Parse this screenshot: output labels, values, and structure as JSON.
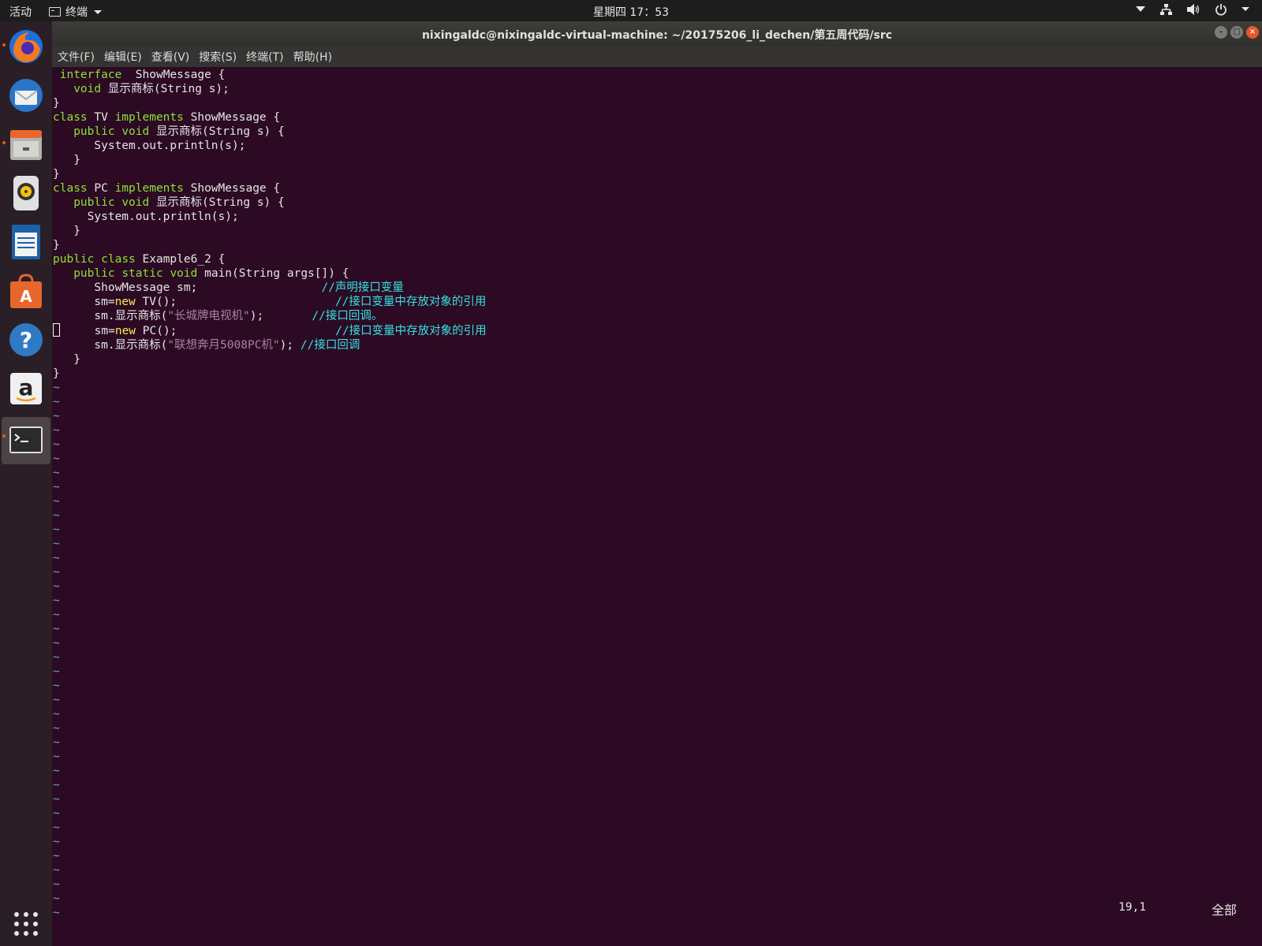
{
  "topbar": {
    "activities": "活动",
    "app_menu": "终端",
    "clock": "星期四 17：53"
  },
  "window": {
    "title": "nixingaldc@nixingaldc-virtual-machine: ~/20175206_li_dechen/第五周代码/src",
    "menu": [
      "文件(F)",
      "编辑(E)",
      "查看(V)",
      "搜索(S)",
      "终端(T)",
      "帮助(H)"
    ]
  },
  "dock": {
    "items": [
      "firefox-icon",
      "thunderbird-icon",
      "files-icon",
      "rhythmbox-icon",
      "writer-icon",
      "software-center-icon",
      "help-icon",
      "amazon-icon",
      "terminal-icon"
    ],
    "show_apps": "app-grid-icon"
  },
  "editor": {
    "lines": [
      [
        {
          "t": " "
        },
        {
          "t": "interface",
          "c": "kw"
        },
        {
          "t": "  ShowMessage {"
        }
      ],
      [
        {
          "t": "   "
        },
        {
          "t": "void",
          "c": "kw"
        },
        {
          "t": " 显示商标(String s);"
        }
      ],
      [
        {
          "t": "}"
        }
      ],
      [
        {
          "t": "class",
          "c": "kw"
        },
        {
          "t": " TV "
        },
        {
          "t": "implements",
          "c": "kw"
        },
        {
          "t": " ShowMessage {"
        }
      ],
      [
        {
          "t": "   "
        },
        {
          "t": "public",
          "c": "kw"
        },
        {
          "t": " "
        },
        {
          "t": "void",
          "c": "kw"
        },
        {
          "t": " 显示商标(String s) {"
        }
      ],
      [
        {
          "t": "      System.out.println(s);"
        }
      ],
      [
        {
          "t": "   }"
        }
      ],
      [
        {
          "t": "}"
        }
      ],
      [
        {
          "t": "class",
          "c": "kw"
        },
        {
          "t": " PC "
        },
        {
          "t": "implements",
          "c": "kw"
        },
        {
          "t": " ShowMessage {"
        }
      ],
      [
        {
          "t": "   "
        },
        {
          "t": "public",
          "c": "kw"
        },
        {
          "t": " "
        },
        {
          "t": "void",
          "c": "kw"
        },
        {
          "t": " 显示商标(String s) {"
        }
      ],
      [
        {
          "t": "     System.out.println(s);"
        }
      ],
      [
        {
          "t": "   }"
        }
      ],
      [
        {
          "t": "}"
        }
      ],
      [
        {
          "t": "public",
          "c": "kw"
        },
        {
          "t": " "
        },
        {
          "t": "class",
          "c": "kw"
        },
        {
          "t": " Example6_2 {"
        }
      ],
      [
        {
          "t": "   "
        },
        {
          "t": "public",
          "c": "kw"
        },
        {
          "t": " "
        },
        {
          "t": "static",
          "c": "kw"
        },
        {
          "t": " "
        },
        {
          "t": "void",
          "c": "kw"
        },
        {
          "t": " main(String args[]) {"
        }
      ],
      [
        {
          "t": "      ShowMessage sm;                  "
        },
        {
          "t": "//声明接口变量",
          "c": "cm"
        }
      ],
      [
        {
          "t": "      sm="
        },
        {
          "t": "new",
          "c": "kw2"
        },
        {
          "t": " TV();                       "
        },
        {
          "t": "//接口变量中存放对象的引用",
          "c": "cm"
        }
      ],
      [
        {
          "t": "      sm.显示商标("
        },
        {
          "t": "\"长城牌电视机\"",
          "c": "str"
        },
        {
          "t": ");       "
        },
        {
          "t": "//接口回调。",
          "c": "cm"
        }
      ],
      [
        {
          "t": "CURSOR",
          "c": "cursor"
        },
        {
          "t": "     sm="
        },
        {
          "t": "new",
          "c": "kw2"
        },
        {
          "t": " PC();                       "
        },
        {
          "t": "//接口变量中存放对象的引用",
          "c": "cm"
        }
      ],
      [
        {
          "t": "      sm.显示商标("
        },
        {
          "t": "\"联想奔月5008PC机\"",
          "c": "str"
        },
        {
          "t": "); "
        },
        {
          "t": "//接口回调",
          "c": "cm"
        }
      ],
      [
        {
          "t": "   }"
        }
      ],
      [
        {
          "t": "}"
        }
      ]
    ],
    "empty_line_marker": "~",
    "empty_line_count": 38,
    "status_position": "19,1",
    "status_scroll": "全部"
  },
  "colors": {
    "background": "#2c0a23",
    "keyword": "#8ae234",
    "new_keyword": "#fce94f",
    "string": "#ad7fa8",
    "comment": "#34e2e2",
    "tilde": "#729fcf"
  }
}
